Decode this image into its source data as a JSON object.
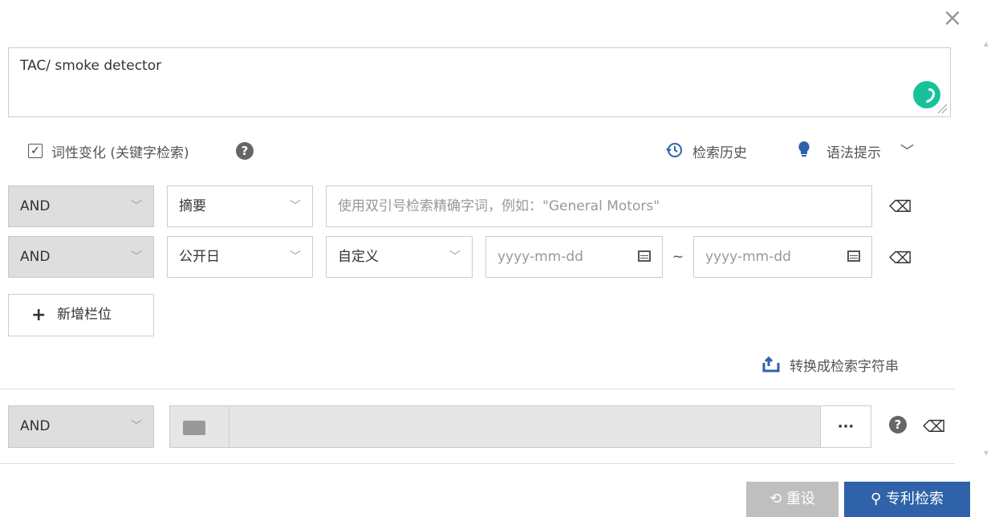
{
  "dialog": {
    "close_icon": "×"
  },
  "query": {
    "value": "TAC/ smoke detector"
  },
  "options": {
    "morph_label": "词性变化 (关键字检索)",
    "history_label": "检索历史",
    "syntax_label": "语法提示"
  },
  "row1": {
    "operator": "AND",
    "field": "摘要",
    "placeholder": "使用双引号检索精确字词，例如：\"General Motors\""
  },
  "row2": {
    "operator": "AND",
    "field": "公开日",
    "range": "自定义",
    "from_placeholder": "yyyy-mm-dd",
    "tilde": "~",
    "to_placeholder": "yyyy-mm-dd"
  },
  "add_field_label": "新增栏位",
  "convert_label": "转换成检索字符串",
  "row3": {
    "operator": "AND",
    "more": "···"
  },
  "footer": {
    "reset_label": "重设",
    "search_label": "专利检索"
  },
  "colors": {
    "primary": "#2f62a9",
    "ai_green": "#17c29b",
    "select_gray": "#dedede"
  }
}
